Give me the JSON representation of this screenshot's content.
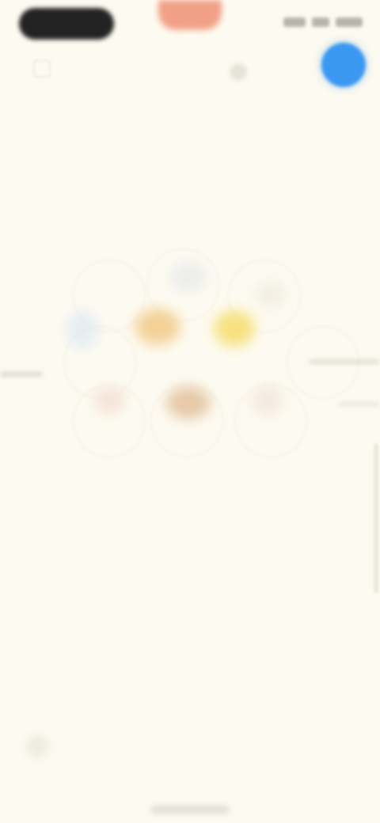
{
  "app": {
    "title": "",
    "background_color": "#fdfbf1"
  },
  "status_bar": {
    "left_pill_color": "#232323",
    "recording_pill_color": "#f1a087"
  },
  "top_controls": {
    "left_icon": "square-icon",
    "center_icon": "dot-icon",
    "fab_icon": "blue-circle-button-icon",
    "fab_color": "#3b98f0"
  },
  "cluster": {
    "items": [
      {
        "name": "top-center-node",
        "icon": "node-icon"
      },
      {
        "name": "left-node",
        "icon": "node-icon"
      },
      {
        "name": "center-left-yellow-node",
        "icon": "node-icon"
      },
      {
        "name": "center-right-yellow-node",
        "icon": "node-icon"
      },
      {
        "name": "right-node",
        "icon": "node-icon"
      },
      {
        "name": "bottom-left-node",
        "icon": "node-icon"
      },
      {
        "name": "bottom-center-node",
        "icon": "node-icon"
      },
      {
        "name": "bottom-right-node",
        "icon": "node-icon"
      }
    ]
  },
  "bottom": {
    "left_icon": "bottom-icon",
    "home_indicator": "home-indicator"
  }
}
